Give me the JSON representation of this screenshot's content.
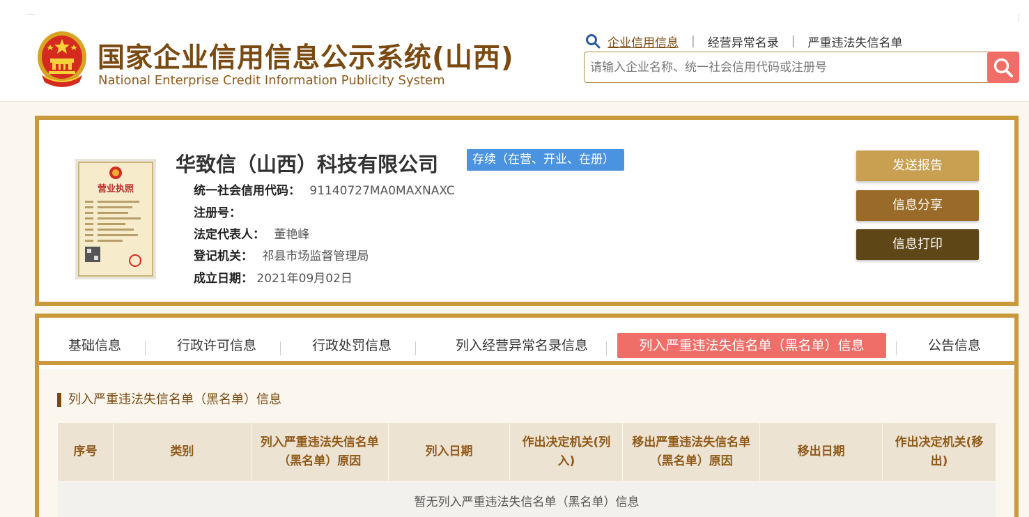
{
  "header": {
    "title_cn": "国家企业信用信息公示系统(山西)",
    "title_en": "National Enterprise Credit Information Publicity System",
    "links": [
      {
        "label": "企业信用信息",
        "active": true
      },
      {
        "label": "经营异常名录",
        "active": false
      },
      {
        "label": "严重违法失信名单",
        "active": false
      }
    ],
    "search": {
      "placeholder": "请输入企业名称、统一社会信用代码或注册号",
      "value": "",
      "button_icon": "search-icon"
    }
  },
  "company": {
    "name": "华致信（山西）科技有限公司",
    "status": "存续（在营、开业、在册）",
    "fields": [
      {
        "label": "统一社会信用代码：",
        "value": "91140727MA0MAXNAXC"
      },
      {
        "label": "注册号：",
        "value": ""
      },
      {
        "label": "法定代表人：",
        "value": "董艳峰"
      },
      {
        "label": "登记机关：",
        "value": "祁县市场监督管理局"
      },
      {
        "label": "成立日期：",
        "value": "2021年09月02日"
      }
    ],
    "license_text": "营业执照",
    "actions": {
      "send_report": "发送报告",
      "share": "信息分享",
      "print": "信息打印"
    }
  },
  "tabs": [
    {
      "label": "基础信息",
      "active": false
    },
    {
      "label": "行政许可信息",
      "active": false
    },
    {
      "label": "行政处罚信息",
      "active": false
    },
    {
      "label": "列入经营异常名录信息",
      "active": false
    },
    {
      "label": "列入严重违法失信名单（黑名单）信息",
      "active": true
    },
    {
      "label": "公告信息",
      "active": false
    }
  ],
  "section": {
    "title": "列入严重违法失信名单（黑名单）信息",
    "columns": [
      "序号",
      "类别",
      "列入严重违法失信名单（黑名单）原因",
      "列入日期",
      "作出决定机关(列入)",
      "移出严重违法失信名单（黑名单）原因",
      "移出日期",
      "作出决定机关(移出)"
    ],
    "empty_message": "暂无列入严重违法失信名单（黑名单）信息"
  },
  "colors": {
    "brand_brown": "#7a4a12",
    "gold_border": "#c99a3c",
    "accent_red": "#f06e68",
    "status_blue": "#4a93e0",
    "btn_report": "#c9a052",
    "btn_share": "#9a6a28",
    "btn_print": "#5e4617"
  }
}
